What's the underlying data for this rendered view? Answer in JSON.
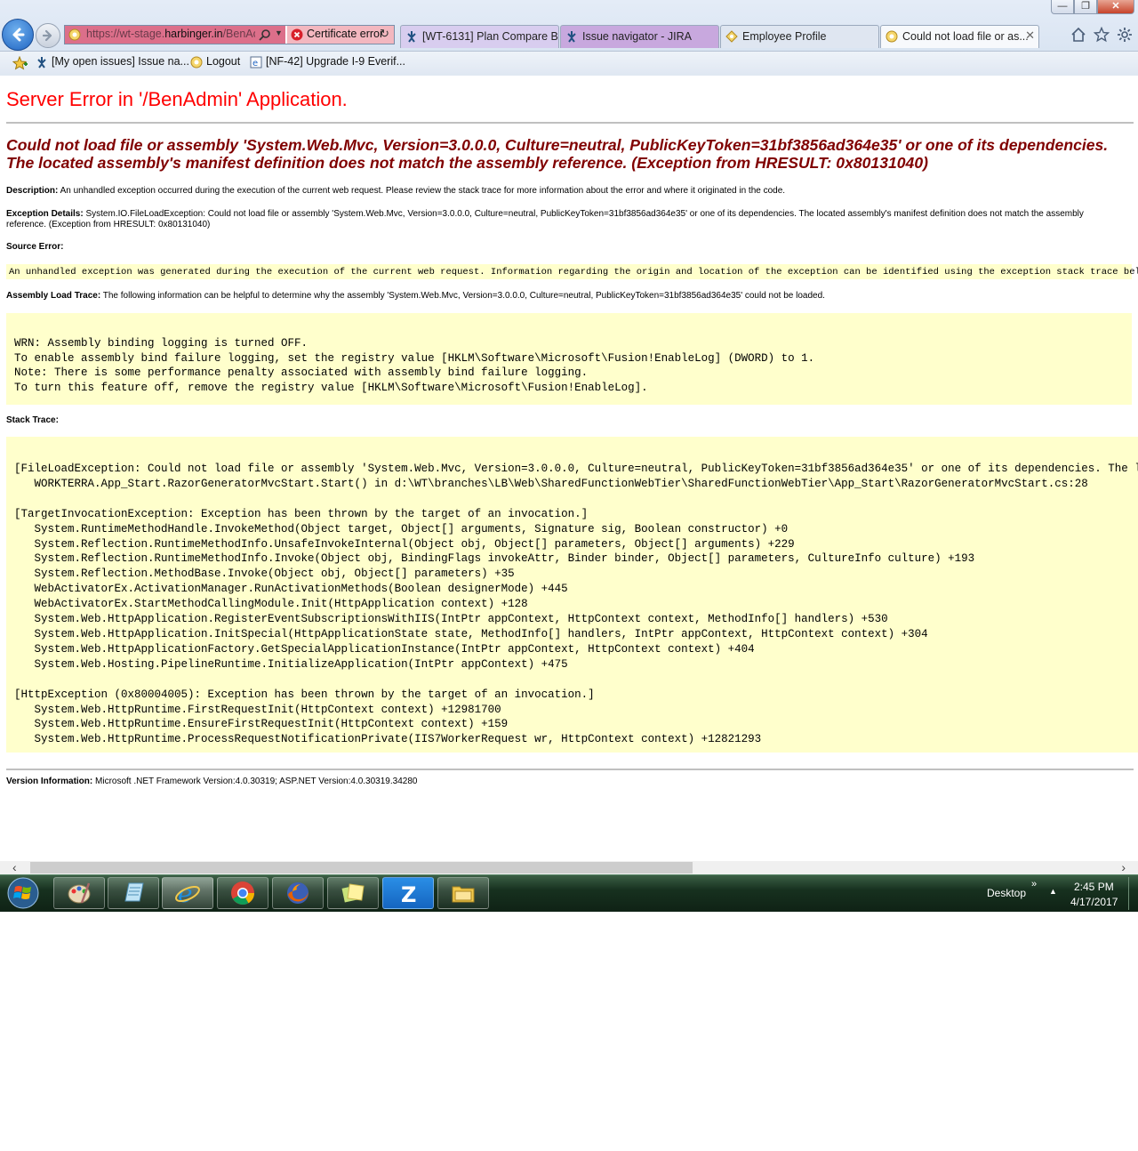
{
  "browser": {
    "address": {
      "url_prefix": "https://wt-stage.",
      "url_domain": "harbinger.in",
      "url_suffix": "/BenAc",
      "cert_error": "Certificate error"
    },
    "tabs": [
      {
        "label": "[WT-6131] Plan Compare B...",
        "icon": "jira-icon"
      },
      {
        "label": "Issue navigator - JIRA",
        "icon": "jira-icon"
      },
      {
        "label": "Employee Profile",
        "icon": "page-icon"
      },
      {
        "label": "Could not load file or as...",
        "icon": "page-icon",
        "close": "✕"
      }
    ],
    "favorites": [
      {
        "label": "[My open issues] Issue na...",
        "icon": "jira-icon"
      },
      {
        "label": "Logout",
        "icon": "page-icon"
      },
      {
        "label": "[NF-42] Upgrade I-9 Everif...",
        "icon": "ie-page-icon"
      }
    ]
  },
  "page": {
    "title": "Server Error in '/BenAdmin' Application.",
    "error_heading": "Could not load file or assembly 'System.Web.Mvc, Version=3.0.0.0, Culture=neutral, PublicKeyToken=31bf3856ad364e35' or one of its dependencies. The located assembly's manifest definition does not match the assembly reference. (Exception from HRESULT: 0x80131040)",
    "description_label": "Description:",
    "description_text": "An unhandled exception occurred during the execution of the current web request. Please review the stack trace for more information about the error and where it originated in the code.",
    "exception_label": "Exception Details:",
    "exception_text": "System.IO.FileLoadException: Could not load file or assembly 'System.Web.Mvc, Version=3.0.0.0, Culture=neutral, PublicKeyToken=31bf3856ad364e35' or one of its dependencies. The located assembly's manifest definition does not match the assembly reference. (Exception from HRESULT: 0x80131040)",
    "source_error_label": "Source Error:",
    "source_error_text": "An unhandled exception was generated during the execution of the current web request. Information regarding the origin and location of the exception can be identified using the exception stack trace below.",
    "assembly_label": "Assembly Load Trace:",
    "assembly_text": "The following information can be helpful to determine why the assembly 'System.Web.Mvc, Version=3.0.0.0, Culture=neutral, PublicKeyToken=31bf3856ad364e35' could not be loaded.",
    "warning_block": "WRN: Assembly binding logging is turned OFF.\nTo enable assembly bind failure logging, set the registry value [HKLM\\Software\\Microsoft\\Fusion!EnableLog] (DWORD) to 1.\nNote: There is some performance penalty associated with assembly bind failure logging.\nTo turn this feature off, remove the registry value [HKLM\\Software\\Microsoft\\Fusion!EnableLog].",
    "stack_label": "Stack Trace:",
    "stack_trace": "[FileLoadException: Could not load file or assembly 'System.Web.Mvc, Version=3.0.0.0, Culture=neutral, PublicKeyToken=31bf3856ad364e35' or one of its dependencies. The located assembly's manifest definition does not match the assembly reference. (Exception from HRESULT: 0x80131040)]\n   WORKTERRA.App_Start.RazorGeneratorMvcStart.Start() in d:\\WT\\branches\\LB\\Web\\SharedFunctionWebTier\\SharedFunctionWebTier\\App_Start\\RazorGeneratorMvcStart.cs:28\n\n[TargetInvocationException: Exception has been thrown by the target of an invocation.]\n   System.RuntimeMethodHandle.InvokeMethod(Object target, Object[] arguments, Signature sig, Boolean constructor) +0\n   System.Reflection.RuntimeMethodInfo.UnsafeInvokeInternal(Object obj, Object[] parameters, Object[] arguments) +229\n   System.Reflection.RuntimeMethodInfo.Invoke(Object obj, BindingFlags invokeAttr, Binder binder, Object[] parameters, CultureInfo culture) +193\n   System.Reflection.MethodBase.Invoke(Object obj, Object[] parameters) +35\n   WebActivatorEx.ActivationManager.RunActivationMethods(Boolean designerMode) +445\n   WebActivatorEx.StartMethodCallingModule.Init(HttpApplication context) +128\n   System.Web.HttpApplication.RegisterEventSubscriptionsWithIIS(IntPtr appContext, HttpContext context, MethodInfo[] handlers) +530\n   System.Web.HttpApplication.InitSpecial(HttpApplicationState state, MethodInfo[] handlers, IntPtr appContext, HttpContext context) +304\n   System.Web.HttpApplicationFactory.GetSpecialApplicationInstance(IntPtr appContext, HttpContext context) +404\n   System.Web.Hosting.PipelineRuntime.InitializeApplication(IntPtr appContext) +475\n\n[HttpException (0x80004005): Exception has been thrown by the target of an invocation.]\n   System.Web.HttpRuntime.FirstRequestInit(HttpContext context) +12981700\n   System.Web.HttpRuntime.EnsureFirstRequestInit(HttpContext context) +159\n   System.Web.HttpRuntime.ProcessRequestNotificationPrivate(IIS7WorkerRequest wr, HttpContext context) +12821293",
    "version_label": "Version Information:",
    "version_text": "Microsoft .NET Framework Version:4.0.30319; ASP.NET Version:4.0.30319.34280"
  },
  "scrollbar": {
    "left_arrow": "‹",
    "right_arrow": "›"
  },
  "taskbar": {
    "apps": [
      "paint",
      "notepad",
      "internet-explorer",
      "chrome",
      "firefox",
      "sticky-notes",
      "zoho",
      "file-explorer"
    ],
    "active_app": "internet-explorer",
    "desktop_label": "Desktop",
    "desktop_chevron": "»",
    "time": "2:45 PM",
    "date": "4/17/2017"
  },
  "colors": {
    "title_red": "#ff0000",
    "heading_maroon": "#800000",
    "code_bg": "#ffffcc",
    "cert_error_bg": "#f3b7bf"
  }
}
